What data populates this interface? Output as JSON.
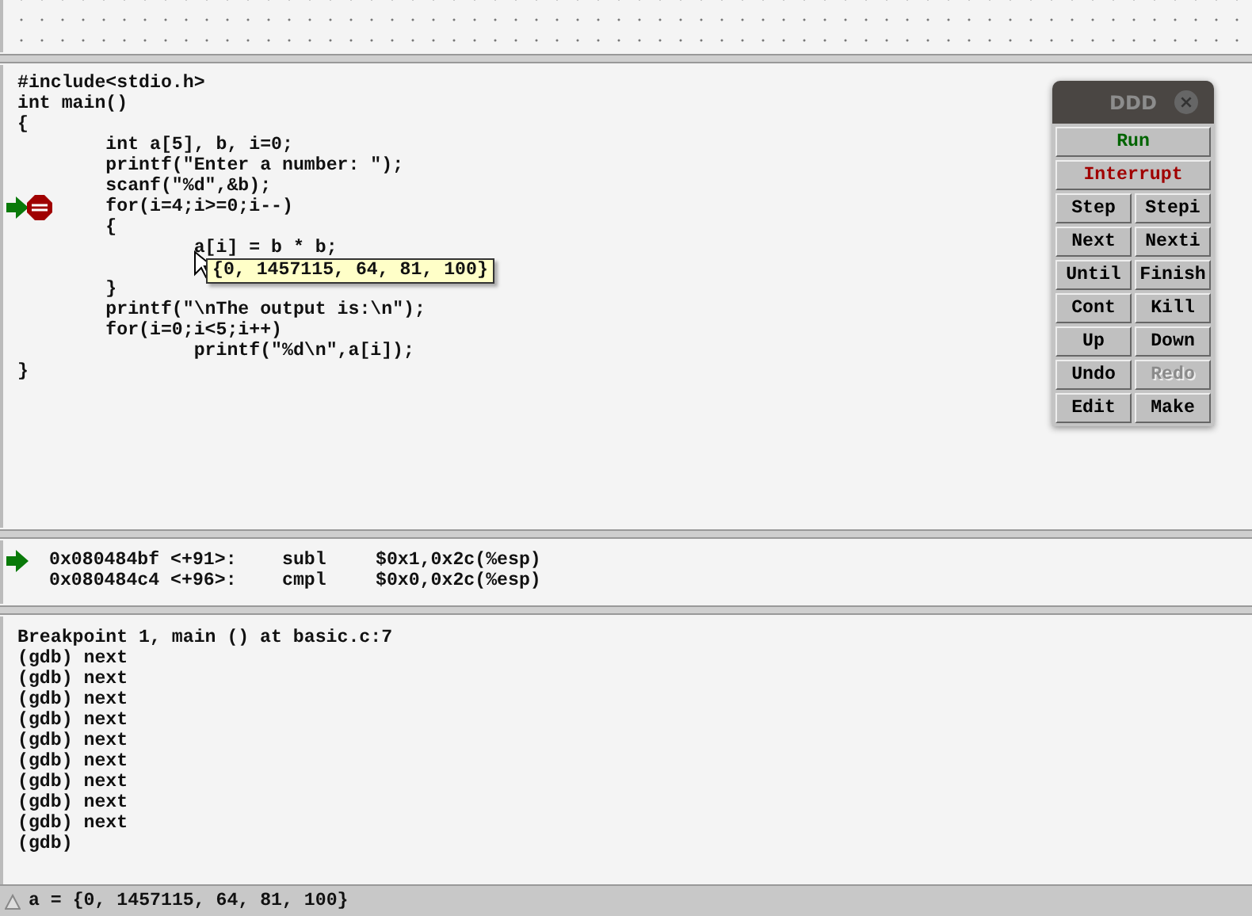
{
  "source": {
    "lines": [
      {
        "text": "#include<stdio.h>",
        "breakpoint": false,
        "current": false
      },
      {
        "text": "int main()",
        "breakpoint": false,
        "current": false
      },
      {
        "text": "{",
        "breakpoint": false,
        "current": false
      },
      {
        "text": "        int a[5], b, i=0;",
        "breakpoint": false,
        "current": false
      },
      {
        "text": "        printf(\"Enter a number: \");",
        "breakpoint": false,
        "current": false
      },
      {
        "text": "        scanf(\"%d\",&b);",
        "breakpoint": false,
        "current": false
      },
      {
        "text": "        for(i=4;i>=0;i--)",
        "breakpoint": true,
        "current": true
      },
      {
        "text": "        {",
        "breakpoint": false,
        "current": false
      },
      {
        "text": "                a[i] = b * b;",
        "breakpoint": false,
        "current": false
      },
      {
        "breakpoint": false,
        "current": false
      },
      {
        "text": "        }",
        "breakpoint": false,
        "current": false
      },
      {
        "text": "        printf(\"\\nThe output is:\\n\");",
        "breakpoint": false,
        "current": false
      },
      {
        "text": "        for(i=0;i<5;i++)",
        "breakpoint": false,
        "current": false
      },
      {
        "text": "                printf(\"%d\\n\",a[i]);",
        "breakpoint": false,
        "current": false
      },
      {
        "text": "}",
        "breakpoint": false,
        "current": false
      }
    ],
    "tooltip": "{0, 1457115, 64, 81, 100}"
  },
  "command_tool": {
    "title": "DDD",
    "buttons": [
      {
        "label": "Run",
        "kind": "wide",
        "color": "#006400",
        "disabled": false
      },
      {
        "label": "Interrupt",
        "kind": "wide",
        "color": "#a00000",
        "disabled": false
      },
      {
        "label": "Step",
        "kind": "half",
        "color": "#000000",
        "disabled": false
      },
      {
        "label": "Stepi",
        "kind": "half",
        "color": "#000000",
        "disabled": false
      },
      {
        "label": "Next",
        "kind": "half",
        "color": "#000000",
        "disabled": false
      },
      {
        "label": "Nexti",
        "kind": "half",
        "color": "#000000",
        "disabled": false
      },
      {
        "label": "Until",
        "kind": "half",
        "color": "#000000",
        "disabled": false
      },
      {
        "label": "Finish",
        "kind": "half",
        "color": "#000000",
        "disabled": false
      },
      {
        "label": "Cont",
        "kind": "half",
        "color": "#000000",
        "disabled": false
      },
      {
        "label": "Kill",
        "kind": "half",
        "color": "#000000",
        "disabled": false
      },
      {
        "label": "Up",
        "kind": "half",
        "color": "#000000",
        "disabled": false
      },
      {
        "label": "Down",
        "kind": "half",
        "color": "#000000",
        "disabled": false
      },
      {
        "label": "Undo",
        "kind": "half",
        "color": "#000000",
        "disabled": false
      },
      {
        "label": "Redo",
        "kind": "half",
        "disabled": true
      },
      {
        "label": "Edit",
        "kind": "half",
        "color": "#000000",
        "disabled": false
      },
      {
        "label": "Make",
        "kind": "half",
        "color": "#000000",
        "disabled": false
      }
    ]
  },
  "machine_code": [
    {
      "address": "0x080484bf <+91>:",
      "op": "subl",
      "args": "$0x1,0x2c(%esp)",
      "current": true
    },
    {
      "address": "0x080484c4 <+96>:",
      "op": "cmpl",
      "args": "$0x0,0x2c(%esp)",
      "current": false
    }
  ],
  "console": [
    "Breakpoint 1, main () at basic.c:7",
    "(gdb) next",
    "(gdb) next",
    "(gdb) next",
    "(gdb) next",
    "(gdb) next",
    "(gdb) next",
    "(gdb) next",
    "(gdb) next",
    "(gdb) next",
    "(gdb)"
  ],
  "status_bar": "a = {0, 1457115, 64, 81, 100}"
}
